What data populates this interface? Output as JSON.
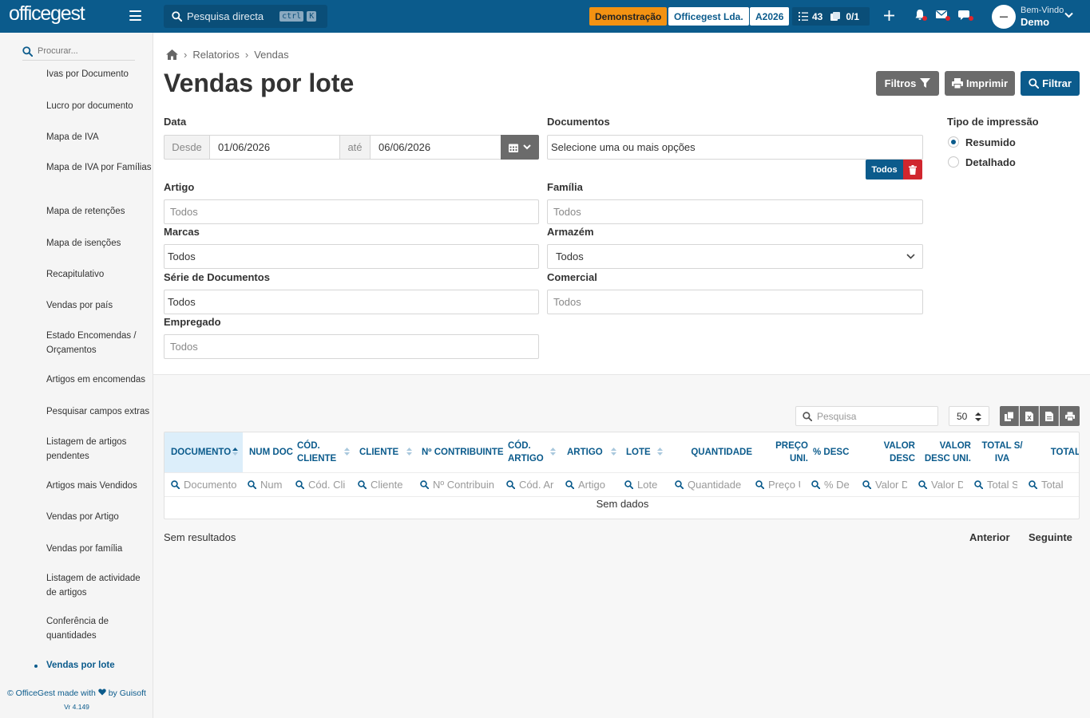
{
  "header": {
    "logo": "officegest",
    "search_label": "Pesquisa directa",
    "kbd_ctrl": "ctrl",
    "kbd_k": "K",
    "demo_badge": "Demonstração",
    "company_badge": "Officegest Lda.",
    "year_badge": "A2026",
    "tasks_count": "43",
    "docs_count": "0/1",
    "welcome": "Bem-Vindo",
    "user": "Demo"
  },
  "sidebar": {
    "search_placeholder": "Procurar...",
    "items": [
      {
        "label": "Ivas por Documento"
      },
      {
        "label": "Lucro por documento"
      },
      {
        "label": "Mapa de IVA"
      },
      {
        "label": "Mapa de IVA por Famílias"
      },
      {
        "label": "Mapa de retenções"
      },
      {
        "label": "Mapa de isenções"
      },
      {
        "label": "Recapitulativo"
      },
      {
        "label": "Vendas por país"
      },
      {
        "label": "Estado Encomendas / Orçamentos"
      },
      {
        "label": "Artigos em encomendas"
      },
      {
        "label": "Pesquisar campos extras"
      },
      {
        "label": "Listagem de artigos pendentes"
      },
      {
        "label": "Artigos mais Vendidos"
      },
      {
        "label": "Vendas por Artigo"
      },
      {
        "label": "Vendas por família"
      },
      {
        "label": "Listagem de actividade de artigos"
      },
      {
        "label": "Conferência de quantidades"
      },
      {
        "label": "Vendas por lote"
      }
    ],
    "footer_prefix": "© OfficeGest made with",
    "footer_suffix": "by Guisoft",
    "version": "Vr 4.149"
  },
  "breadcrumb": [
    "Relatorios",
    "Vendas"
  ],
  "page_title": "Vendas por lote",
  "actions": {
    "filtros": "Filtros",
    "imprimir": "Imprimir",
    "filtrar": "Filtrar"
  },
  "form": {
    "data_label": "Data",
    "desde": "Desde",
    "date_from": "01/06/2026",
    "ate": "até",
    "date_to": "06/06/2026",
    "documentos_label": "Documentos",
    "documentos_value": "Selecione uma ou mais opções",
    "todos_button": "Todos",
    "tipo_label": "Tipo de impressão",
    "tipo_options": [
      "Resumido",
      "Detalhado"
    ],
    "artigo_label": "Artigo",
    "artigo_placeholder": "Todos",
    "familia_label": "Família",
    "familia_placeholder": "Todos",
    "marcas_label": "Marcas",
    "marcas_value": "Todos",
    "armazem_label": "Armazém",
    "armazem_value": "Todos",
    "serie_label": "Série de Documentos",
    "serie_value": "Todos",
    "comercial_label": "Comercial",
    "comercial_placeholder": "Todos",
    "empregado_label": "Empregado",
    "empregado_placeholder": "Todos"
  },
  "table": {
    "search_placeholder": "Pesquisa",
    "page_size": "50",
    "columns": [
      {
        "label": "DOCUMENTO",
        "filter": "Documento"
      },
      {
        "label": "NUM DOC",
        "filter": "Num"
      },
      {
        "label": "CÓD. CLIENTE",
        "filter": "Cód. Cli"
      },
      {
        "label": "CLIENTE",
        "filter": "Cliente"
      },
      {
        "label": "Nº CONTRIBUINTE",
        "filter": "Nº Contribuin"
      },
      {
        "label": "CÓD. ARTIGO",
        "filter": "Cód. Ar"
      },
      {
        "label": "ARTIGO",
        "filter": "Artigo"
      },
      {
        "label": "LOTE",
        "filter": "Lote"
      },
      {
        "label": "QUANTIDADE",
        "filter": "Quantidade"
      },
      {
        "label": "PREÇO UNI.",
        "filter": "Preço U"
      },
      {
        "label": "% DESC",
        "filter": "% De"
      },
      {
        "label": "VALOR DESC",
        "filter": "Valor D"
      },
      {
        "label": "VALOR DESC UNI.",
        "filter": "Valor D"
      },
      {
        "label": "TOTAL S/ IVA",
        "filter": "Total S"
      },
      {
        "label": "TOTAL",
        "filter": "Total"
      }
    ],
    "empty_text": "Sem dados",
    "result_text": "Sem resultados",
    "prev": "Anterior",
    "next": "Seguinte"
  },
  "colors": {
    "brand": "#0b5b8c",
    "demo": "#f39212",
    "danger": "#d0262e",
    "button_gray": "#6b6b6b"
  }
}
